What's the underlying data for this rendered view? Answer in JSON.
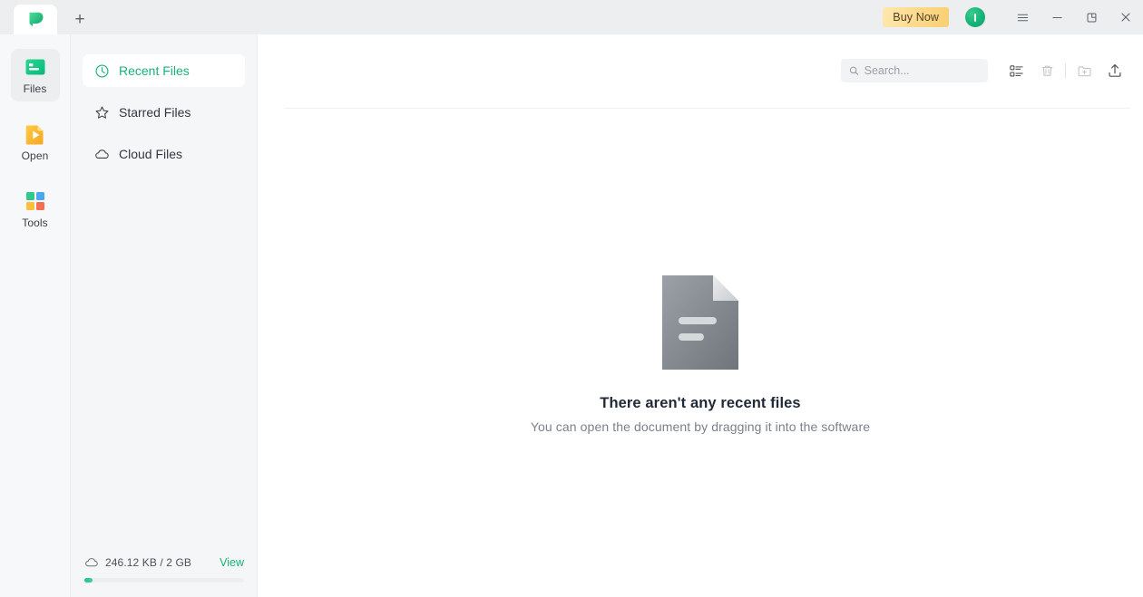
{
  "titlebar": {
    "tab": {
      "name": "active-tab",
      "logo_icon": "app-logo-leaf-icon"
    },
    "new_tab_glyph": "+",
    "buy_now_label": "Buy Now",
    "avatar_icon": "user-avatar-icon",
    "menu_icon": "hamburger-menu-icon",
    "minimize_icon": "minimize-icon",
    "restore_icon": "restore-window-icon",
    "close_icon": "close-icon"
  },
  "rail": {
    "items": [
      {
        "label": "Files",
        "icon": "files-icon",
        "active": true
      },
      {
        "label": "Open",
        "icon": "open-file-icon",
        "active": false
      },
      {
        "label": "Tools",
        "icon": "tools-grid-icon",
        "active": false
      }
    ]
  },
  "nav": {
    "items": [
      {
        "label": "Recent Files",
        "icon": "clock-icon",
        "active": true
      },
      {
        "label": "Starred Files",
        "icon": "star-icon",
        "active": false
      },
      {
        "label": "Cloud Files",
        "icon": "cloud-icon",
        "active": false
      }
    ]
  },
  "storage": {
    "icon": "cloud-icon",
    "usage_text": "246.12 KB / 2 GB",
    "view_label": "View",
    "used_percent": 5
  },
  "toolbar": {
    "search_placeholder": "Search...",
    "search_value": "",
    "search_icon": "search-icon",
    "list_view_icon": "list-view-icon",
    "delete_icon": "trash-icon",
    "new_folder_icon": "new-folder-icon",
    "upload_icon": "upload-icon"
  },
  "empty_state": {
    "icon": "empty-document-icon",
    "title": "There aren't any recent files",
    "subtitle": "You can open the document by dragging it into the software"
  },
  "colors": {
    "accent_green": "#19b277",
    "buy_now_amber": "#f8cf72",
    "titlebar_bg": "#eceef0",
    "panel_bg": "#f5f6f7",
    "text_primary": "#33383e",
    "text_muted": "#7b8189"
  }
}
